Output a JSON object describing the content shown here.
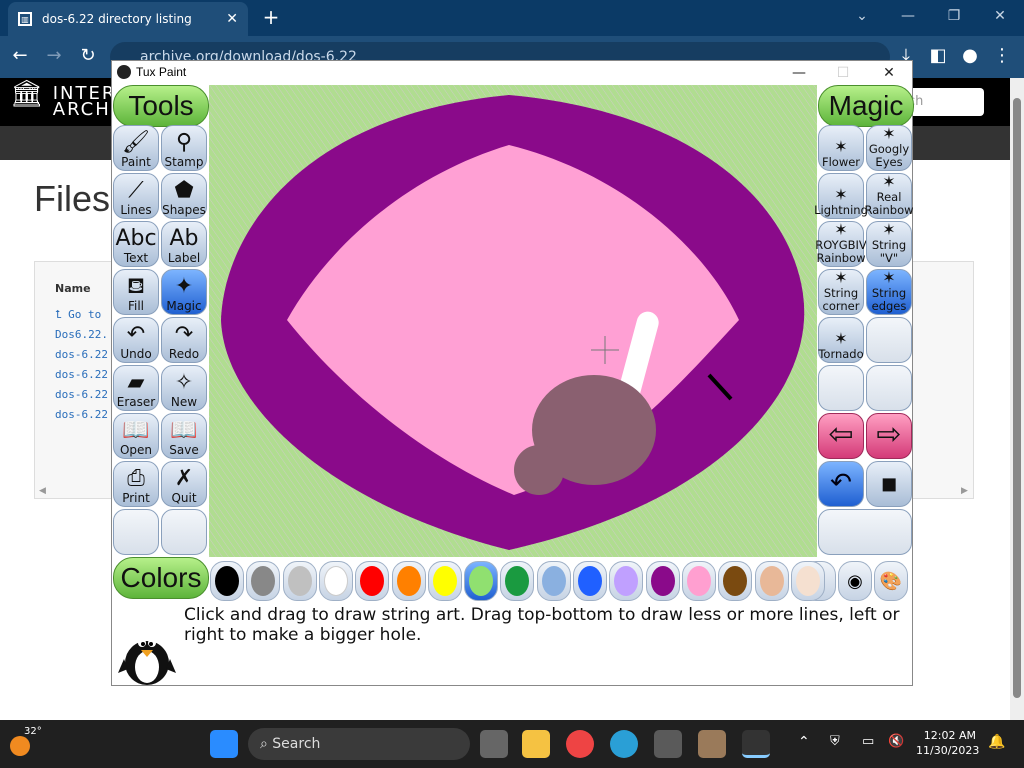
{
  "browser": {
    "tab_title": "dos-6.22 directory listing",
    "url": "archive.org/download/dos-6.22"
  },
  "site": {
    "logo_line1": "INTERN",
    "logo_line2": "ARCHIV",
    "search_placeholder": "ch",
    "heading": "Files",
    "table_header": "Name",
    "rows": [
      "Go to",
      "Dos6.22.",
      "dos-6.22",
      "dos-6.22",
      "dos-6.22",
      "dos-6.22"
    ]
  },
  "tuxpaint": {
    "window_title": "Tux Paint",
    "tools_header": "Tools",
    "magic_header": "Magic",
    "colors_header": "Colors",
    "tools": [
      {
        "label": "Paint",
        "icon": "paintbrush-icon",
        "glyph": "🖌"
      },
      {
        "label": "Stamp",
        "icon": "stamp-icon",
        "glyph": "⚲"
      },
      {
        "label": "Lines",
        "icon": "lines-icon",
        "glyph": "⟋"
      },
      {
        "label": "Shapes",
        "icon": "pentagon-icon",
        "glyph": "⬟"
      },
      {
        "label": "Text",
        "icon": "text-icon",
        "glyph": "Abc"
      },
      {
        "label": "Label",
        "icon": "label-icon",
        "glyph": "Ab"
      },
      {
        "label": "Fill",
        "icon": "bucket-icon",
        "glyph": "⛾"
      },
      {
        "label": "Magic",
        "icon": "magic-wand-icon",
        "glyph": "✦"
      },
      {
        "label": "Undo",
        "icon": "undo-icon",
        "glyph": "↶"
      },
      {
        "label": "Redo",
        "icon": "redo-icon",
        "glyph": "↷"
      },
      {
        "label": "Eraser",
        "icon": "eraser-icon",
        "glyph": "▰"
      },
      {
        "label": "New",
        "icon": "new-page-icon",
        "glyph": "✧"
      },
      {
        "label": "Open",
        "icon": "open-book-icon",
        "glyph": "📖"
      },
      {
        "label": "Save",
        "icon": "save-icon",
        "glyph": "📖"
      },
      {
        "label": "Print",
        "icon": "printer-icon",
        "glyph": "⎙"
      },
      {
        "label": "Quit",
        "icon": "quit-icon",
        "glyph": "✗"
      }
    ],
    "magic": [
      {
        "label1": "Flower",
        "label2": "",
        "icon": "flower-icon"
      },
      {
        "label1": "Googly",
        "label2": "Eyes",
        "icon": "googly-eyes-icon"
      },
      {
        "label1": "Lightning",
        "label2": "",
        "icon": "lightning-icon"
      },
      {
        "label1": "Real",
        "label2": "Rainbow",
        "icon": "rainbow-icon"
      },
      {
        "label1": "ROYGBIV",
        "label2": "Rainbow",
        "icon": "roygbiv-icon"
      },
      {
        "label1": "String \"V\"",
        "label2": "",
        "icon": "string-v-icon"
      },
      {
        "label1": "String",
        "label2": "corner",
        "icon": "string-corner-icon"
      },
      {
        "label1": "String",
        "label2": "edges",
        "icon": "string-edges-icon"
      },
      {
        "label1": "Tornado",
        "label2": "",
        "icon": "tornado-icon"
      }
    ],
    "colors": [
      "#000000",
      "#888888",
      "#c0c0c0",
      "#ffffff",
      "#ff0000",
      "#ff8000",
      "#ffff00",
      "#90e070",
      "#1a9a40",
      "#8ab0e0",
      "#2060ff",
      "#c0a0ff",
      "#8a0a8a",
      "#ff9fd0",
      "#7a4a10",
      "#e8b898",
      "#f5e0d0"
    ],
    "message": "Click and drag to draw string art. Drag top-bottom to draw less or more lines, left or right to make a bigger hole."
  },
  "taskbar": {
    "temperature": "32°",
    "search_label": "Search",
    "time": "12:02 AM",
    "date": "11/30/2023"
  }
}
